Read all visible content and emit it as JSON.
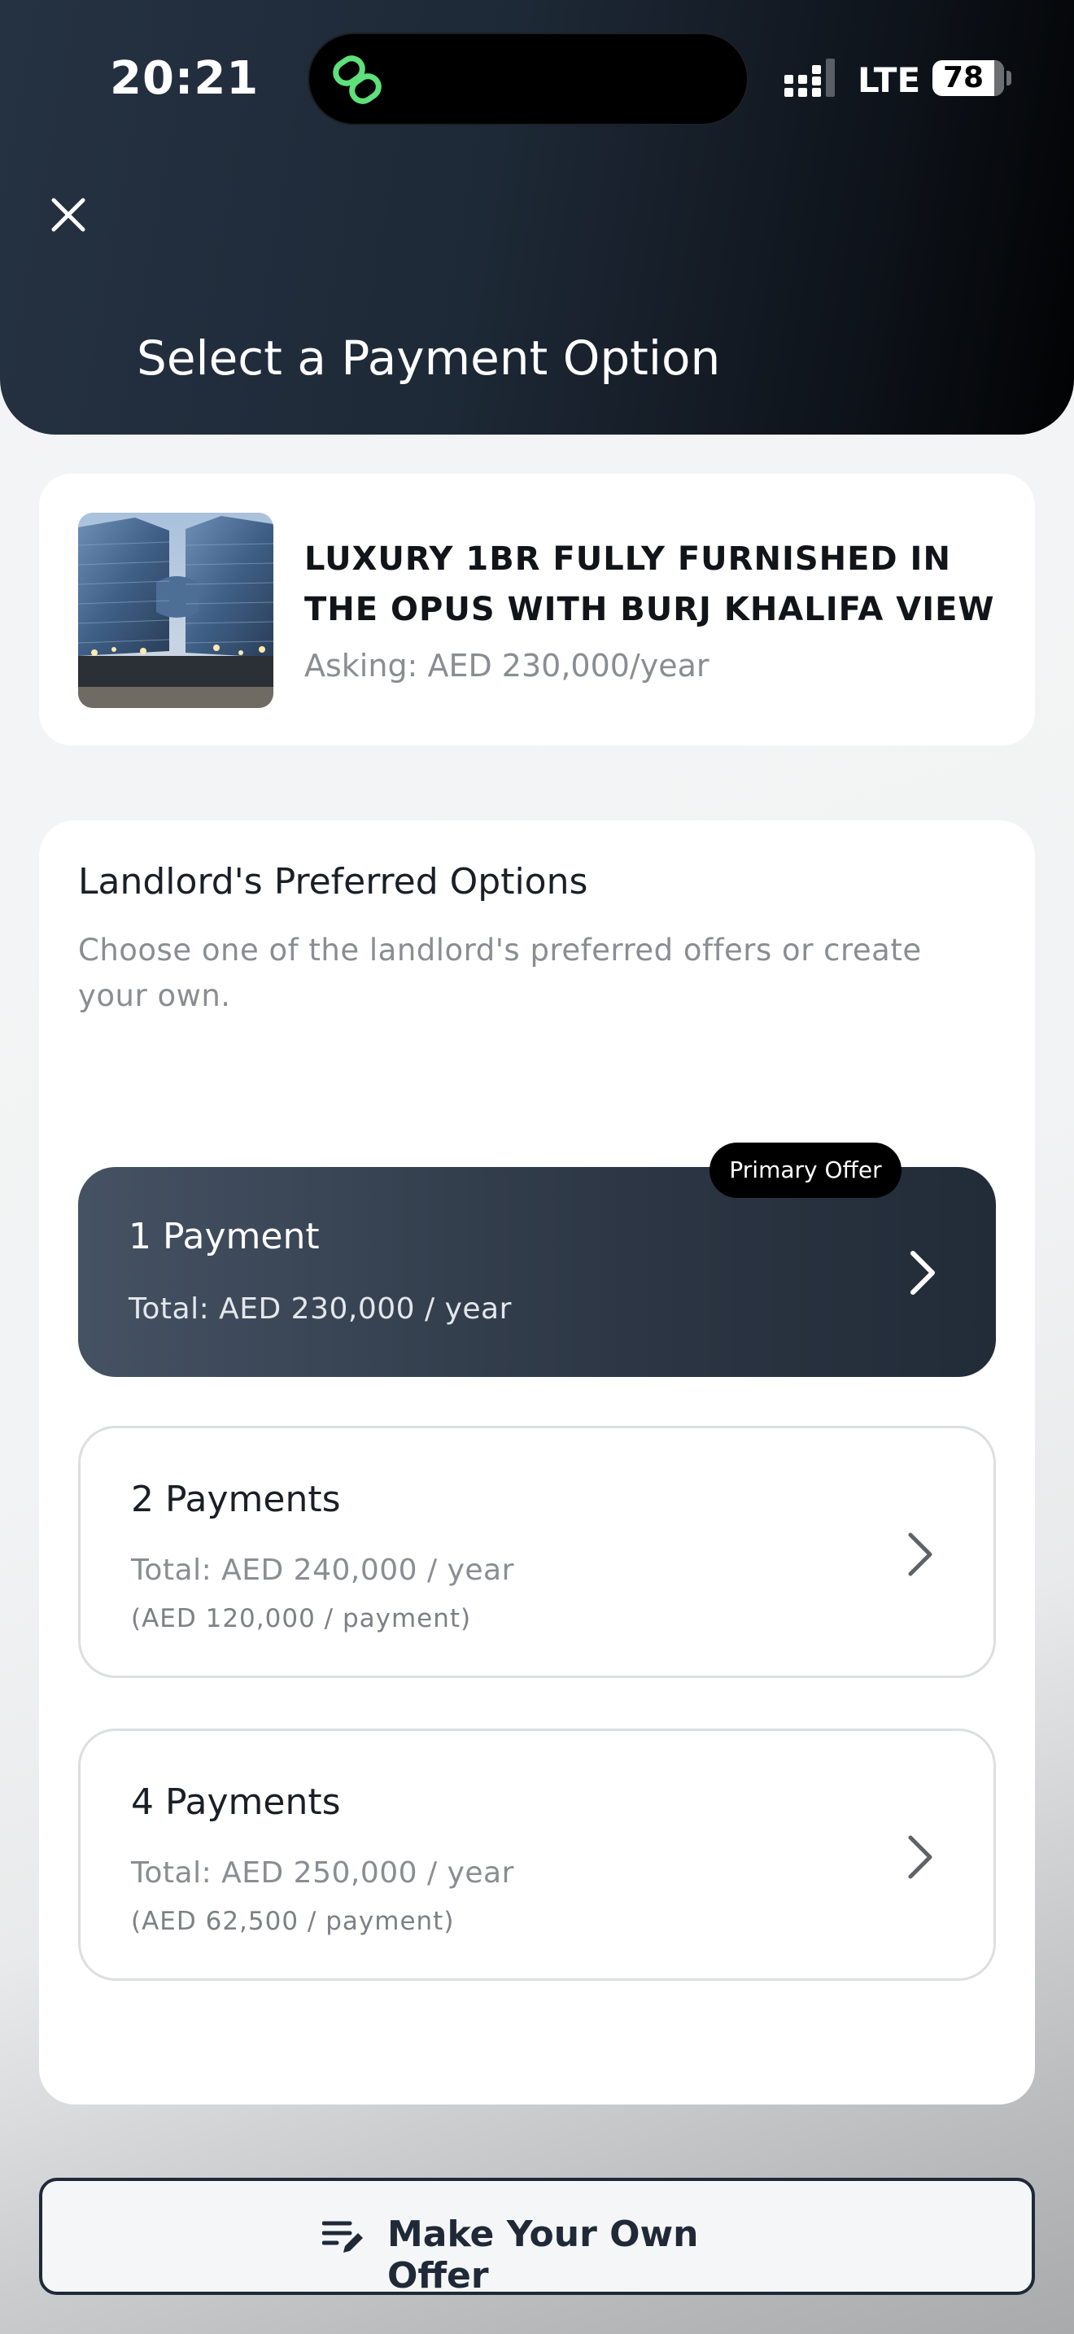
{
  "status_bar": {
    "time": "20:21",
    "network": "LTE",
    "battery": "78",
    "battery_level": 0.78
  },
  "header": {
    "title": "Select a Payment Option",
    "close_icon": "close-icon"
  },
  "listing": {
    "title": "LUXURY 1BR FULLY FURNISHED IN THE OPUS WITH BURJ KHALIFA VIEW",
    "price": "Asking: AED 230,000/year"
  },
  "preferred": {
    "title": "Landlord's Preferred Options",
    "description": "Choose one of the landlord's preferred offers or create your own.",
    "badge": "Primary Offer",
    "options": [
      {
        "title": "1 Payment",
        "total": "Total: AED 230,000 / year"
      },
      {
        "title": "2 Payments",
        "total": "Total: AED 240,000 / year",
        "per_payment": "(AED 120,000 / payment)"
      },
      {
        "title": "4 Payments",
        "total": "Total: AED 250,000 / year",
        "per_payment": "(AED 62,500 / payment)"
      }
    ]
  },
  "actions": {
    "own_offer": "Make Your Own Offer",
    "own_offer_icon": "edit-list-icon"
  },
  "colors": {
    "header_bg": "#1e2937",
    "primary_option_bg": "#2c3644",
    "accent_green": "#4ade80",
    "text_dark": "#1a1f27",
    "text_muted": "#8a8d91"
  }
}
